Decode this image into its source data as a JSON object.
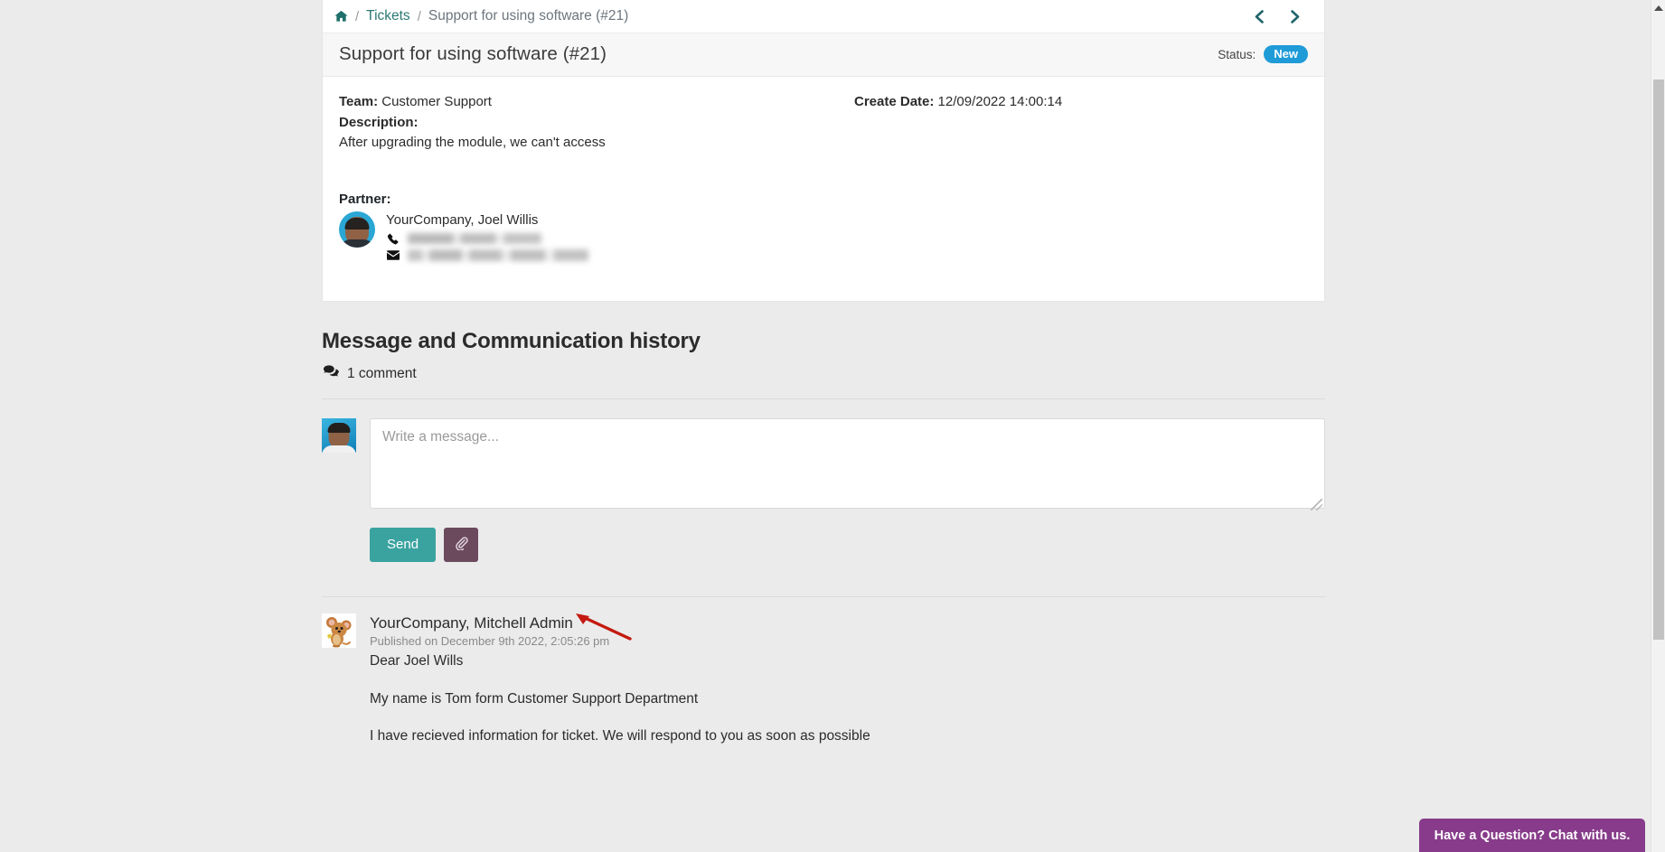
{
  "breadcrumb": {
    "home_icon": "home-icon",
    "separator": "/",
    "tickets_label": "Tickets",
    "current_label": "Support for using software (#21)"
  },
  "nav": {
    "prev_icon": "chevron-left-icon",
    "next_icon": "chevron-right-icon"
  },
  "ticket": {
    "title": "Support for using software (#21)",
    "status_label": "Status:",
    "status_value": "New",
    "status_color": "#1f9bd8",
    "team_label": "Team:",
    "team_value": "Customer Support",
    "description_label": "Description:",
    "description_value": "After upgrading the module, we can't access",
    "create_date_label": "Create Date:",
    "create_date_value": "12/09/2022 14:00:14",
    "partner_label": "Partner:",
    "partner_name": "YourCompany, Joel Willis",
    "partner_phone_redacted": "",
    "partner_email_redacted": "",
    "phone_icon": "phone-icon",
    "email_icon": "envelope-icon",
    "partner_avatar": "partner-avatar"
  },
  "history": {
    "heading": "Message and Communication history",
    "comment_icon": "comments-icon",
    "comment_count_label": "1 comment"
  },
  "composer": {
    "avatar": "current-user-avatar",
    "placeholder": "Write a message...",
    "value": "",
    "send_label": "Send",
    "send_color": "#3aa3a0",
    "attach_icon": "paperclip-icon",
    "attach_color": "#6b4a5e"
  },
  "messages": [
    {
      "avatar": "mouse-avatar",
      "author": "YourCompany, Mitchell Admin",
      "published": "Published on December 9th 2022, 2:05:26 pm",
      "line1": "Dear Joel Wills",
      "line2": "My name is Tom form Customer Support Department",
      "line3": "I have recieved information for ticket. We will respond to you as soon as possible"
    }
  ],
  "annotation": {
    "arrow_color": "#c41a10",
    "name": "red-pointer-arrow"
  },
  "chat_widget": {
    "label": "Have a Question? Chat with us.",
    "color": "#873b8a",
    "caret_icon": "caret-down-icon"
  },
  "scrollbar": {
    "up_icon": "scroll-up-arrow"
  }
}
